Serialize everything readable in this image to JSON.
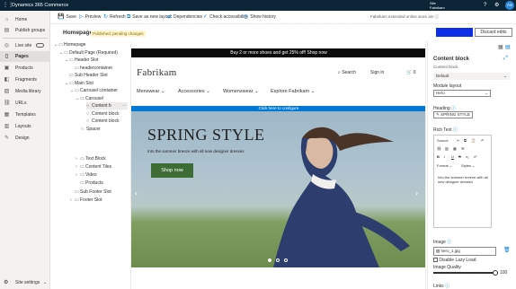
{
  "topbar": {
    "waffle": "⋮⋮",
    "app_title": "Dynamics 365 Commerce",
    "site_label": "Site",
    "site_name": "Fabrikam",
    "help": "?",
    "settings": "⚙",
    "avatar": "AS"
  },
  "nav": {
    "items": [
      {
        "label": "Home",
        "icon": "⌂"
      },
      {
        "label": "Publish groups",
        "icon": "▤"
      },
      {
        "label": "Live site",
        "icon": "◎",
        "has_toggle": true
      },
      {
        "label": "Pages",
        "icon": "▯"
      },
      {
        "label": "Products",
        "icon": "▣"
      },
      {
        "label": "Fragments",
        "icon": "◧"
      },
      {
        "label": "Media library",
        "icon": "▨"
      },
      {
        "label": "URLs",
        "icon": "⛓"
      },
      {
        "label": "Templates",
        "icon": "▦"
      },
      {
        "label": "Layouts",
        "icon": "▥"
      },
      {
        "label": "Design",
        "icon": "✎"
      }
    ],
    "selected": "Pages",
    "settings_label": "Site settings"
  },
  "commands": [
    {
      "label": "Save",
      "icon": "💾"
    },
    {
      "label": "Preview",
      "icon": "▷"
    },
    {
      "label": "Refresh",
      "icon": "↻"
    },
    {
      "label": "Save as new layout",
      "icon": "⧉"
    },
    {
      "label": "Dependencies",
      "icon": "⇄"
    },
    {
      "label": "Check accessibility",
      "icon": "✓"
    },
    {
      "label": "Show history",
      "icon": "◷"
    }
  ],
  "publish_info": "Fabrikam extended online store  am ⓘ",
  "page": {
    "title": "Homepage",
    "status": "Published, pending changes",
    "primary_button": "",
    "discard_button": "Discard edits"
  },
  "outline": [
    {
      "label": "Homepage",
      "chevron": "⌄",
      "icon": "▭"
    },
    {
      "label": "Default Page (Required)",
      "chevron": "⌄",
      "icon": "▭"
    },
    {
      "label": "Header Slot",
      "chevron": "⌄",
      "icon": "▭"
    },
    {
      "label": "headercontainer",
      "chevron": "",
      "icon": "▭"
    },
    {
      "label": "Sub Header Slot",
      "chevron": "",
      "icon": "▭"
    },
    {
      "label": "Main Slot",
      "chevron": "⌄",
      "icon": "▭"
    },
    {
      "label": "Carousel container",
      "chevron": "⌄",
      "icon": "▭"
    },
    {
      "label": "Carousel",
      "chevron": "⌄",
      "icon": "▭"
    },
    {
      "label": "Content b",
      "chevron": "",
      "icon": "○"
    },
    {
      "label": "Content block",
      "chevron": "",
      "icon": "○"
    },
    {
      "label": "Content block",
      "chevron": "",
      "icon": "○"
    },
    {
      "label": "Spacer",
      "chevron": "",
      "icon": "○"
    },
    {
      "label": "Text Block",
      "chevron": "›",
      "icon": "▭"
    },
    {
      "label": "Content Tiles",
      "chevron": "›",
      "icon": "▭"
    },
    {
      "label": "Video",
      "chevron": "›",
      "icon": "▭"
    },
    {
      "label": "Products",
      "chevron": "",
      "icon": "▭"
    },
    {
      "label": "Sub Footer Slot",
      "chevron": "",
      "icon": "▭"
    },
    {
      "label": "Footer Slot",
      "chevron": "›",
      "icon": "▭"
    }
  ],
  "outline_selected": "Content b",
  "site": {
    "promo": "Buy 2 or more shoes and get 25% off!  Shop now",
    "brand": "Fabrikam",
    "search": "Search",
    "signin": "Sign in",
    "cart": "0",
    "menu": [
      "Menswear",
      "Accessories",
      "Womenswear",
      "Explore Fabrikam"
    ],
    "configure_bar": "Click here to configure",
    "hero_heading": "SPRING STYLE",
    "hero_subtext": "Into the summer breeze with all new designer dresses",
    "hero_button": "Shop now"
  },
  "props": {
    "title": "Content block",
    "subtitle": "Content block",
    "variant": "Default",
    "module_layout_label": "Module layout",
    "module_layout": "Hero",
    "heading_label": "Heading",
    "heading_value": "SPRING STYLE",
    "richtext_label": "Rich Text",
    "toolbar": [
      "Source",
      "B",
      "I",
      "U",
      "S",
      "x₂",
      "x²",
      "Format",
      "Styles"
    ],
    "richtext_value": "Into the summer breeze with all new designer dresses",
    "image_label": "Image",
    "image_file": "hero_1.jpg",
    "lazy_label": "Disable Lazy Load",
    "quality_label": "Image Quality",
    "quality_value": "100",
    "links_label": "Links"
  },
  "colors": {
    "topbar": "#0b2537",
    "accent": "#0078d4",
    "primary_button": "#0f2fe6",
    "hero_button": "#3d6d34"
  }
}
